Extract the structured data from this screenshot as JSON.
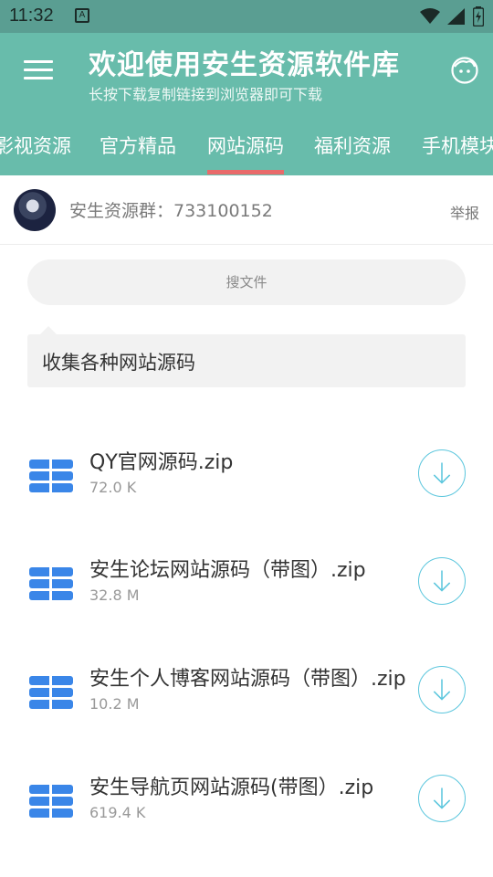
{
  "status_bar": {
    "time": "11:32",
    "notification_icon": "a-notification-icon",
    "icons": [
      "wifi-icon",
      "signal-icon",
      "battery-charging-icon"
    ]
  },
  "header": {
    "title": "欢迎使用安生资源软件库",
    "subtitle": "长按下载复制链接到浏览器即可下载",
    "menu_icon": "hamburger-menu-icon",
    "face_icon": "face-icon",
    "bg_color": "#68bcab"
  },
  "tabs": [
    {
      "label": "影视资源",
      "active": false
    },
    {
      "label": "官方精品",
      "active": false
    },
    {
      "label": "网站源码",
      "active": true
    },
    {
      "label": "福利资源",
      "active": false
    },
    {
      "label": "手机模块",
      "active": false
    }
  ],
  "group": {
    "text": "安生资源群：733100152",
    "report_label": "举报"
  },
  "search": {
    "placeholder": "搜文件"
  },
  "description": "收集各种网站源码",
  "files": [
    {
      "name": "QY官网源码.zip",
      "size": "72.0 K"
    },
    {
      "name": "安生论坛网站源码（带图）.zip",
      "size": "32.8 M"
    },
    {
      "name": "安生个人博客网站源码（带图）.zip",
      "size": "10.2 M"
    },
    {
      "name": "安生导航页网站源码(带图）.zip",
      "size": "619.4 K"
    }
  ],
  "colors": {
    "accent": "#68bcab",
    "tab_underline": "#e96b6b",
    "download_ring": "#5bc6dd",
    "file_icon": "#3a86e8"
  }
}
